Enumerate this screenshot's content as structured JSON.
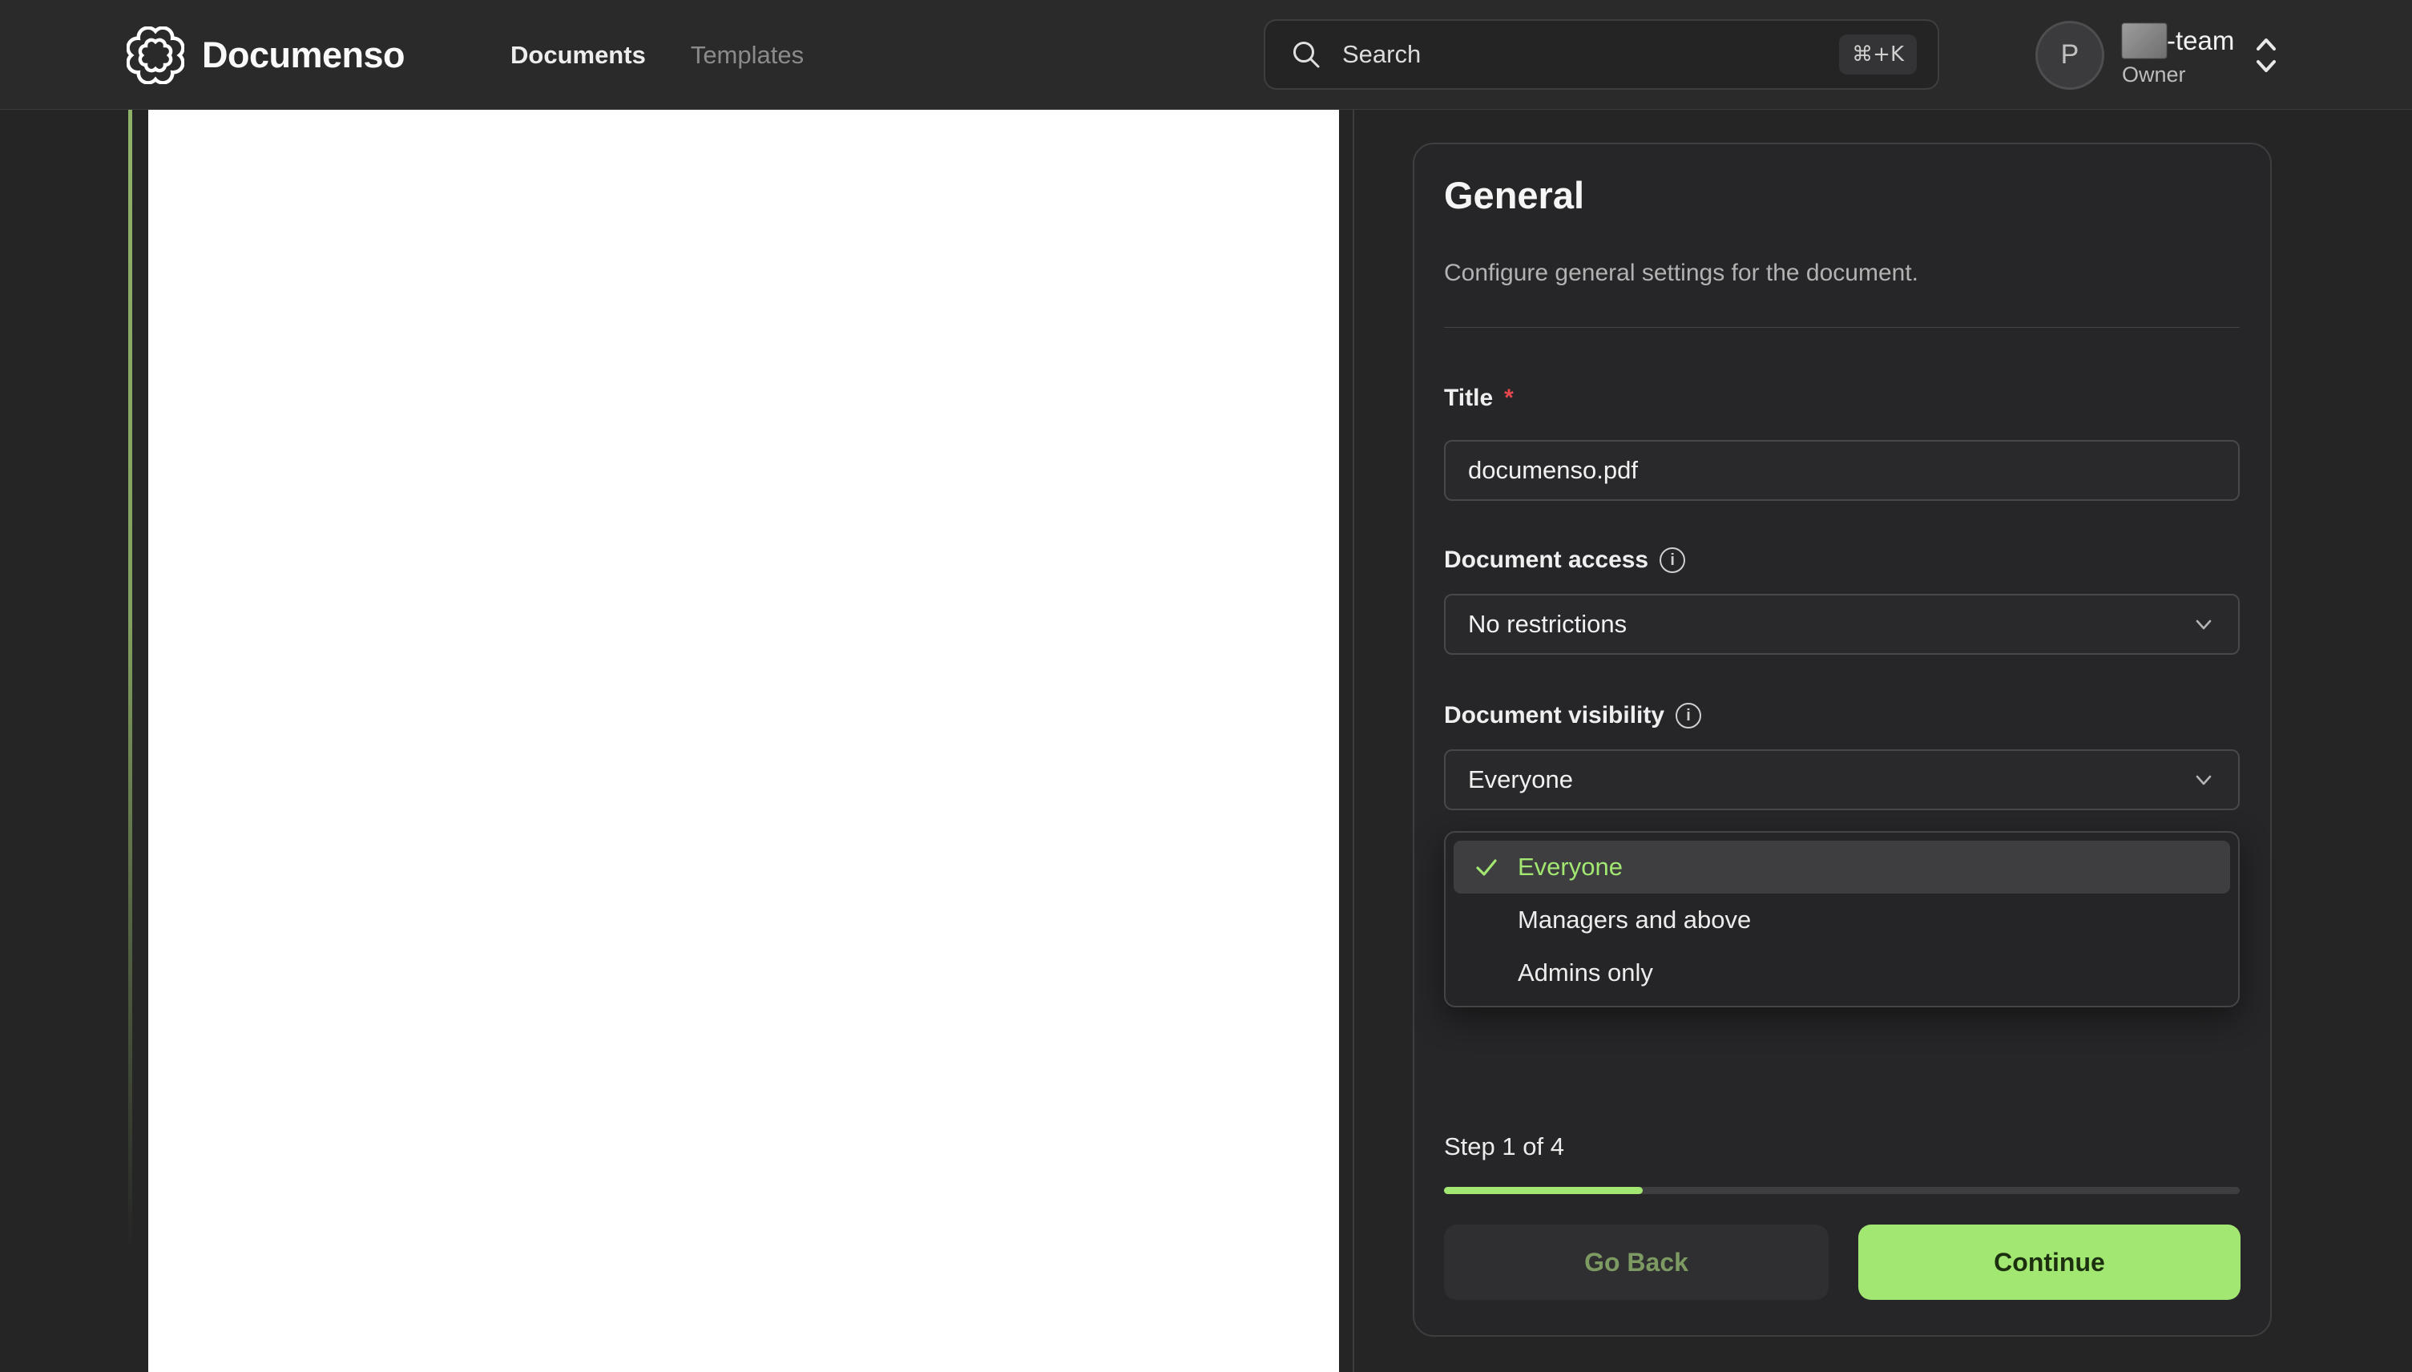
{
  "header": {
    "brand": "Documenso",
    "nav": {
      "documents": "Documents",
      "templates": "Templates"
    },
    "search": {
      "placeholder": "Search",
      "shortcut": "⌘+K"
    },
    "account": {
      "initial": "P",
      "team_suffix": "-team",
      "role": "Owner"
    }
  },
  "panel": {
    "title": "General",
    "subtitle": "Configure general settings for the document.",
    "title_field": {
      "label": "Title",
      "required_mark": "*",
      "value": "documenso.pdf"
    },
    "access_field": {
      "label": "Document access",
      "value": "No restrictions"
    },
    "visibility_field": {
      "label": "Document visibility",
      "value": "Everyone"
    },
    "visibility_options": [
      {
        "label": "Everyone",
        "selected": true
      },
      {
        "label": "Managers and above",
        "selected": false
      },
      {
        "label": "Admins only",
        "selected": false
      }
    ],
    "step": {
      "text": "Step 1 of 4",
      "progress_percent": 25
    },
    "buttons": {
      "back": "Go Back",
      "continue": "Continue"
    }
  },
  "colors": {
    "accent_green": "#A2E771",
    "selected_option_text": "#A2E771",
    "required_red": "#e5484d",
    "continue_text": "#1c3010"
  }
}
